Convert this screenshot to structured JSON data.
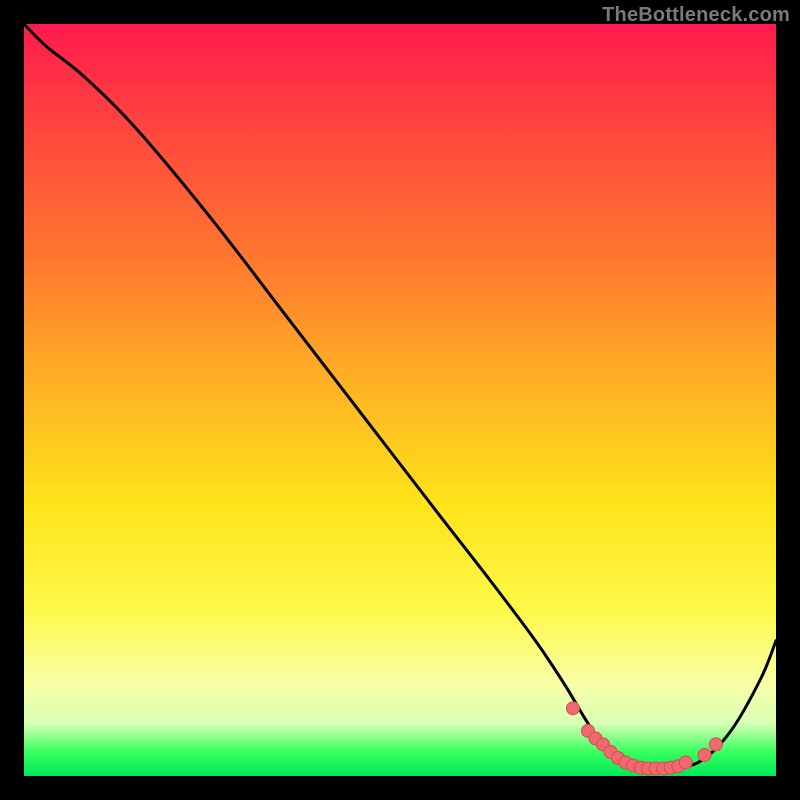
{
  "watermark": "TheBottleneck.com",
  "colors": {
    "background": "#000000",
    "curve": "#000000",
    "marker_fill": "#ee6a6e",
    "marker_stroke": "#d94a52"
  },
  "chart_data": {
    "type": "line",
    "title": "",
    "xlabel": "",
    "ylabel": "",
    "xlim": [
      0,
      100
    ],
    "ylim": [
      0,
      100
    ],
    "note": "x is horizontal position (0=left,100=right); y is the curve height (0=bottom green to 100=top red). Curve starts high-left, descends nearly linearly, bottoms out ~x 78–90, then rises toward the right edge.",
    "series": [
      {
        "name": "bottleneck-curve",
        "x": [
          0,
          3,
          8,
          15,
          25,
          35,
          45,
          55,
          62,
          68,
          72,
          75,
          78,
          82,
          86,
          90,
          94,
          98,
          100
        ],
        "y": [
          100,
          97,
          93,
          86,
          74,
          61,
          48,
          35,
          26,
          18,
          12,
          7,
          3,
          1,
          1,
          2,
          6,
          13,
          18
        ]
      }
    ],
    "markers": {
      "name": "optimal-region-dots",
      "x": [
        73,
        75,
        76,
        77,
        78,
        79,
        80,
        81,
        82,
        83,
        84,
        85,
        86,
        87,
        88,
        90.5,
        92
      ],
      "y": [
        9,
        6,
        5,
        4.2,
        3.2,
        2.4,
        1.8,
        1.4,
        1.1,
        1.0,
        1.0,
        1.0,
        1.1,
        1.3,
        1.8,
        2.8,
        4.2
      ]
    }
  }
}
